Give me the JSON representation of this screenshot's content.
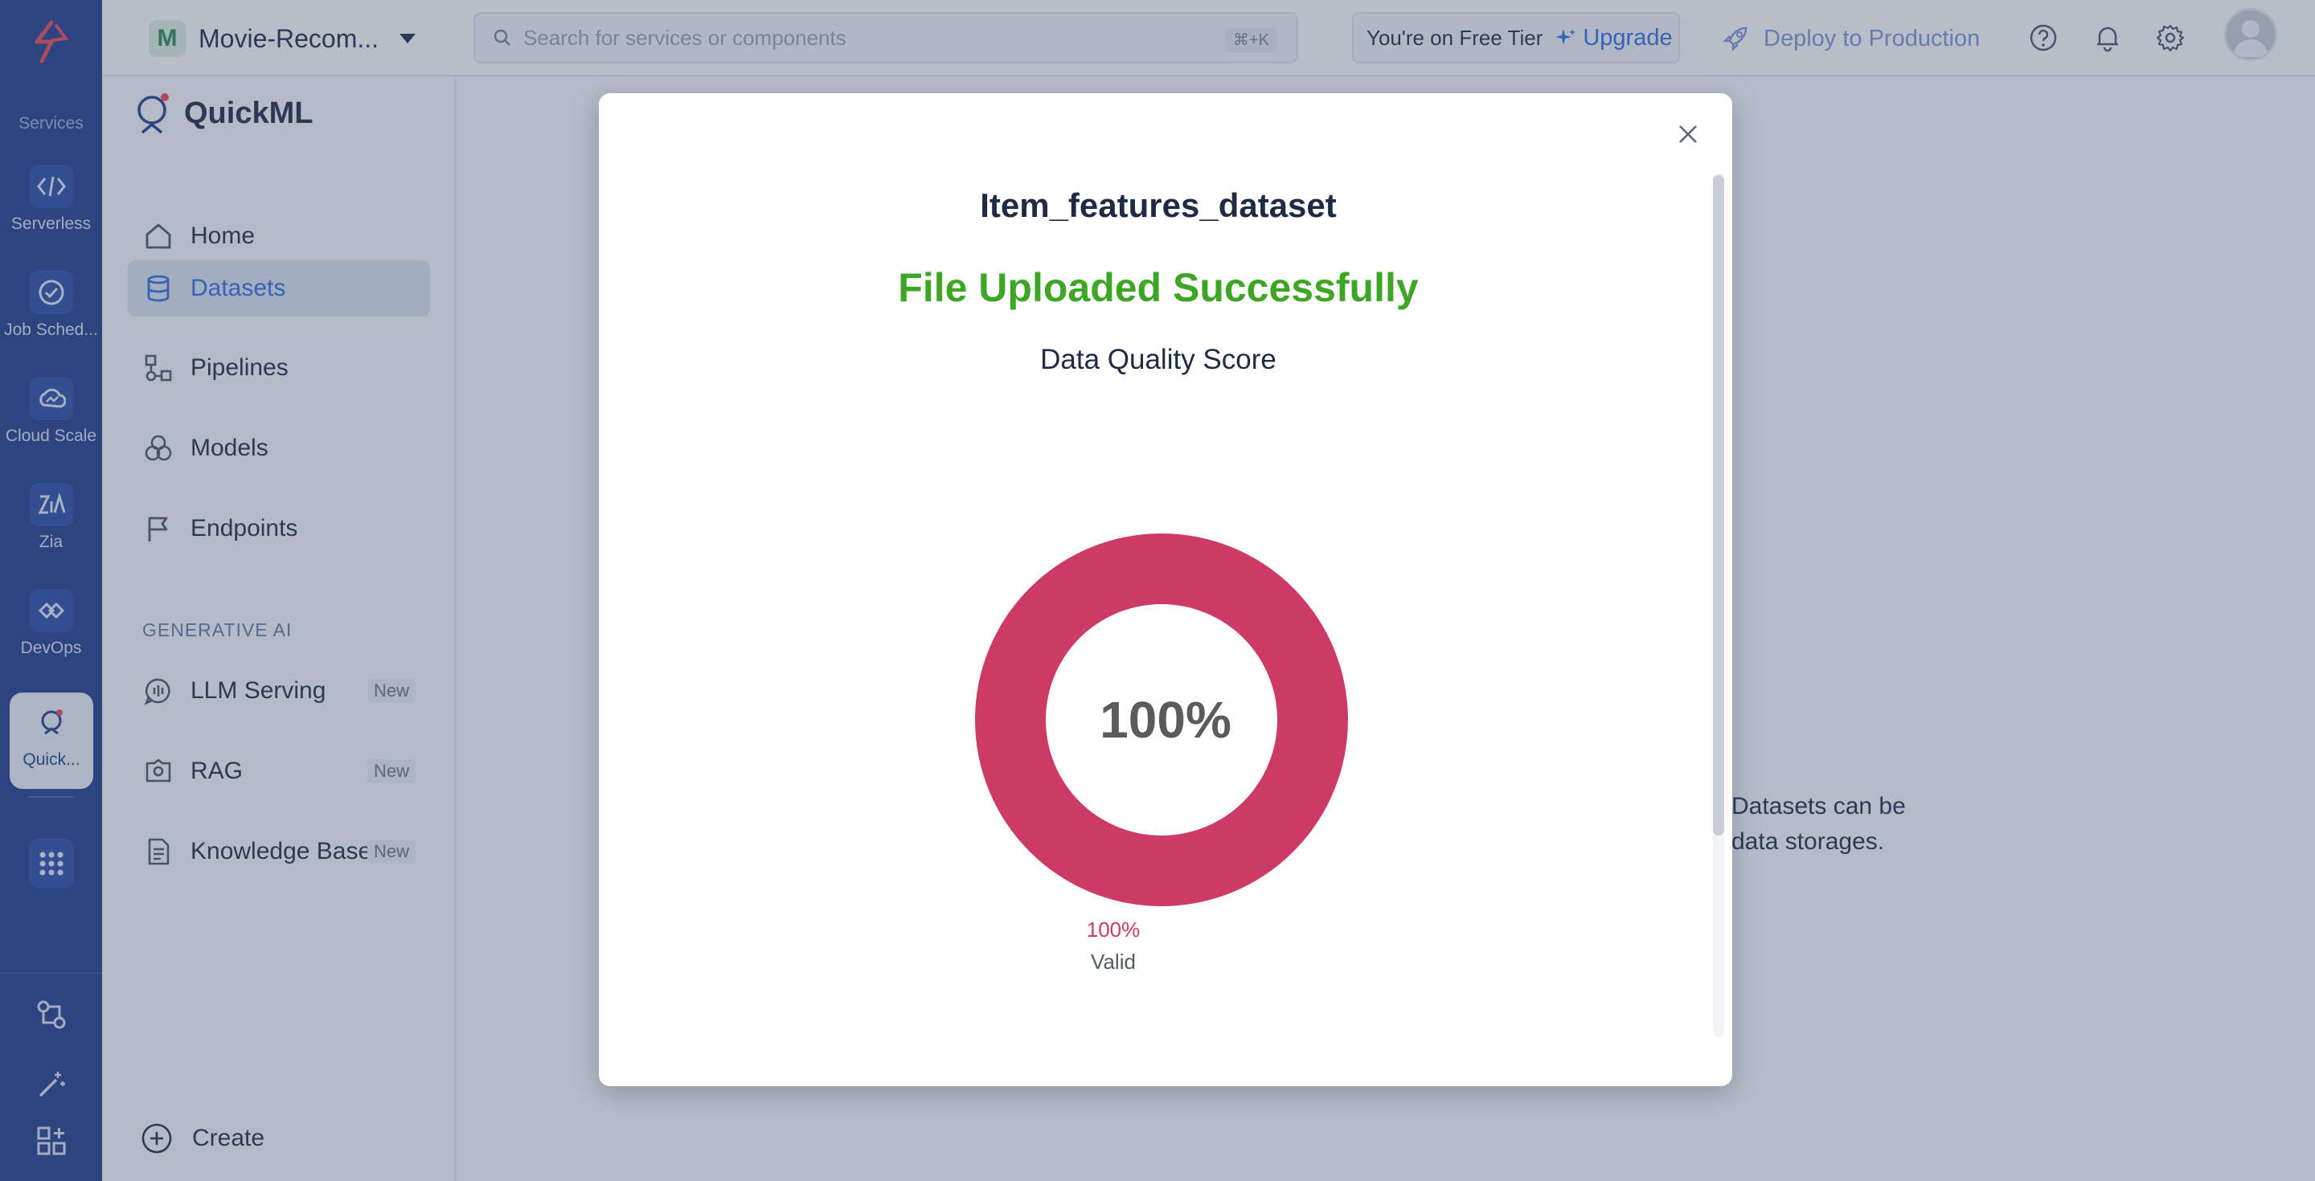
{
  "rail": {
    "section_label": "Services",
    "items": [
      {
        "label": "Serverless",
        "icon": "serverless-icon"
      },
      {
        "label": "Job Sched...",
        "icon": "job-scheduler-icon"
      },
      {
        "label": "Cloud Scale",
        "icon": "cloud-scale-icon"
      },
      {
        "label": "Zia",
        "icon": "zia-icon"
      },
      {
        "label": "DevOps",
        "icon": "devops-icon"
      },
      {
        "label": "Quick...",
        "icon": "quickml-icon"
      }
    ]
  },
  "header": {
    "project_initial": "M",
    "project_name": "Movie-Recom...",
    "search_placeholder": "Search for services or components",
    "search_shortcut": "⌘+K",
    "tier_text": "You're on Free Tier",
    "upgrade_label": "Upgrade",
    "deploy_label": "Deploy to Production"
  },
  "sidenav": {
    "brand": "QuickML",
    "items": [
      {
        "label": "Home"
      },
      {
        "label": "Datasets"
      },
      {
        "label": "Pipelines"
      },
      {
        "label": "Models"
      },
      {
        "label": "Endpoints"
      }
    ],
    "section": "GENERATIVE AI",
    "genai_items": [
      {
        "label": "LLM Serving",
        "badge": "New"
      },
      {
        "label": "RAG",
        "badge": "New"
      },
      {
        "label": "Knowledge Base",
        "badge": "New"
      }
    ],
    "create_label": "Create"
  },
  "content": {
    "info_line1": "Datasets can be",
    "info_line2": "data storages."
  },
  "modal": {
    "title": "Item_features_dataset",
    "status": "File Uploaded Successfully",
    "score_heading": "Data Quality Score"
  },
  "chart_data": {
    "type": "pie",
    "categories": [
      "Valid"
    ],
    "values": [
      100
    ],
    "center_label": "100%",
    "legend": [
      {
        "name": "Valid",
        "value": "100%"
      }
    ],
    "colors": [
      "#cd3a66"
    ]
  },
  "colors": {
    "rail": "#1f3d8c",
    "accent": "#2f6ee0",
    "success": "#3ea625",
    "donut": "#cd3a66"
  }
}
